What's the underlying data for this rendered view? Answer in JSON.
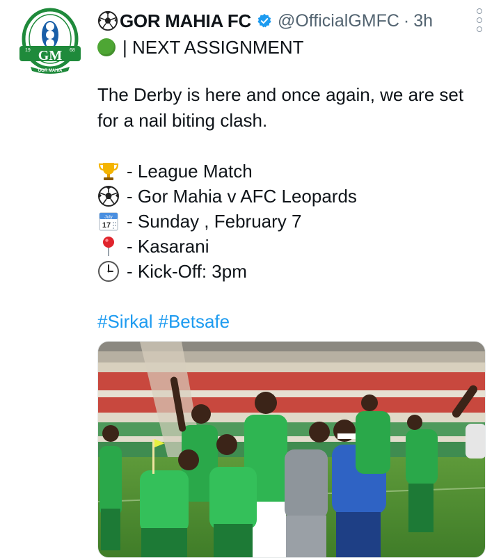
{
  "tweet": {
    "display_name": "GOR MAHIA FC",
    "handle": "@OfficialGMFC",
    "separator": "·",
    "time": "3h",
    "subtitle": "| NEXT ASSIGNMENT",
    "body_line1": "The Derby is here and once again, we are set",
    "body_line2": "for a nail biting clash.",
    "details": [
      {
        "icon": "trophy-icon",
        "text": "-  League Match"
      },
      {
        "icon": "soccer-ball-icon",
        "text": "- Gor Mahia v AFC Leopards"
      },
      {
        "icon": "calendar-icon",
        "text": "- Sunday , February 7"
      },
      {
        "icon": "round-pushpin-icon",
        "text": "- Kasarani"
      },
      {
        "icon": "clock-icon",
        "text": "- Kick-Off: 3pm"
      }
    ],
    "calendar_month": "July",
    "calendar_day": "17",
    "hashtags": [
      "#Sirkal",
      "#Betsafe"
    ]
  },
  "avatar": {
    "year_left": "19",
    "year_right": "68",
    "monogram": "GM",
    "banner_text": "GOR MAHIA"
  },
  "colors": {
    "name_text": "#0f1419",
    "meta_text": "#536471",
    "link": "#1d9bf0",
    "verified": "#1d9bf0",
    "club_green": "#1f8a3b"
  }
}
